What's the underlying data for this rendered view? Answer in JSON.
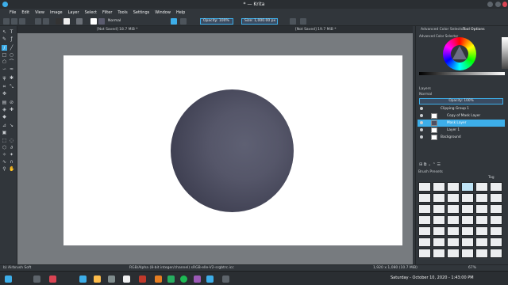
{
  "window": {
    "title": "* — Krita"
  },
  "menubar": [
    "File",
    "Edit",
    "View",
    "Image",
    "Layer",
    "Select",
    "Filter",
    "Tools",
    "Settings",
    "Window",
    "Help"
  ],
  "toolbar": {
    "blend_mode": "Normal",
    "opacity": "Opacity: 100%",
    "size": "Size: 1,000.00 px"
  },
  "tabs": [
    {
      "label": "[Not Saved] 18.7 MiB *"
    },
    {
      "label": "[Not Saved] 19.7 MiB *"
    }
  ],
  "docker": {
    "tab_advanced": "Advanced Color Selector",
    "tab_tool": "Tool Options",
    "color_title": "Advanced Color Selector",
    "layers_title": "Layers",
    "blend": "Normal",
    "opacity": "Opacity: 100%",
    "layers": [
      {
        "name": "Clipping Group 1"
      },
      {
        "name": "Copy of Mask Layer"
      },
      {
        "name": "Mask Layer"
      },
      {
        "name": "Layer 1"
      },
      {
        "name": "Background"
      }
    ],
    "brush_title": "Brush Presets",
    "brush_tag": "Tag"
  },
  "status": {
    "brush": "b) Airbrush Soft",
    "color": "RGB/Alpha (8-bit integer/channel)  sRGB-elle-V2-srgbtrc.icc",
    "dims": "1,920 x 1,080 (10.7 MiB)",
    "zoom": "67%"
  },
  "taskbar": {
    "datetime": "Saturday - October 10, 2020 - 1:43:00 PM"
  },
  "colors": {
    "accent": "#3daee9",
    "sphere": "#4e4f62"
  }
}
